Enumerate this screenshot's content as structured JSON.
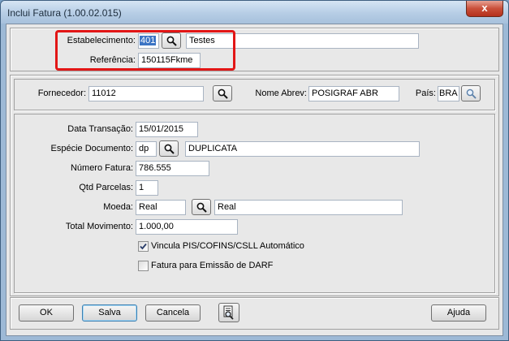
{
  "window": {
    "title": "Inclui Fatura (1.00.02.015)",
    "close_glyph": "x"
  },
  "header": {
    "estabelecimento_label": "Estabelecimento:",
    "estabelecimento_code": "401",
    "estabelecimento_name": "Testes",
    "referencia_label": "Referência:",
    "referencia_value": "150115Fkme"
  },
  "fornecedor": {
    "label": "Fornecedor:",
    "value": "11012",
    "nome_abrev_label": "Nome Abrev:",
    "nome_abrev_value": "POSIGRAF ABR",
    "pais_label": "País:",
    "pais_value": "BRA"
  },
  "details": {
    "data_transacao_label": "Data Transação:",
    "data_transacao_value": "15/01/2015",
    "especie_label": "Espécie Documento:",
    "especie_code": "dp",
    "especie_desc": "DUPLICATA",
    "numero_label": "Número  Fatura:",
    "numero_value": "786.555",
    "parcelas_label": "Qtd Parcelas:",
    "parcelas_value": "1",
    "moeda_label": "Moeda:",
    "moeda_code": "Real",
    "moeda_desc": "Real",
    "total_label": "Total  Movimento:",
    "total_value": "1.000,00",
    "vincula_label": "Vincula PIS/COFINS/CSLL Automático",
    "vincula_checked": true,
    "darf_label": "Fatura para Emissão de DARF",
    "darf_checked": false
  },
  "footer": {
    "ok_label": "OK",
    "salva_label": "Salva",
    "cancela_label": "Cancela",
    "ajuda_label": "Ajuda"
  }
}
